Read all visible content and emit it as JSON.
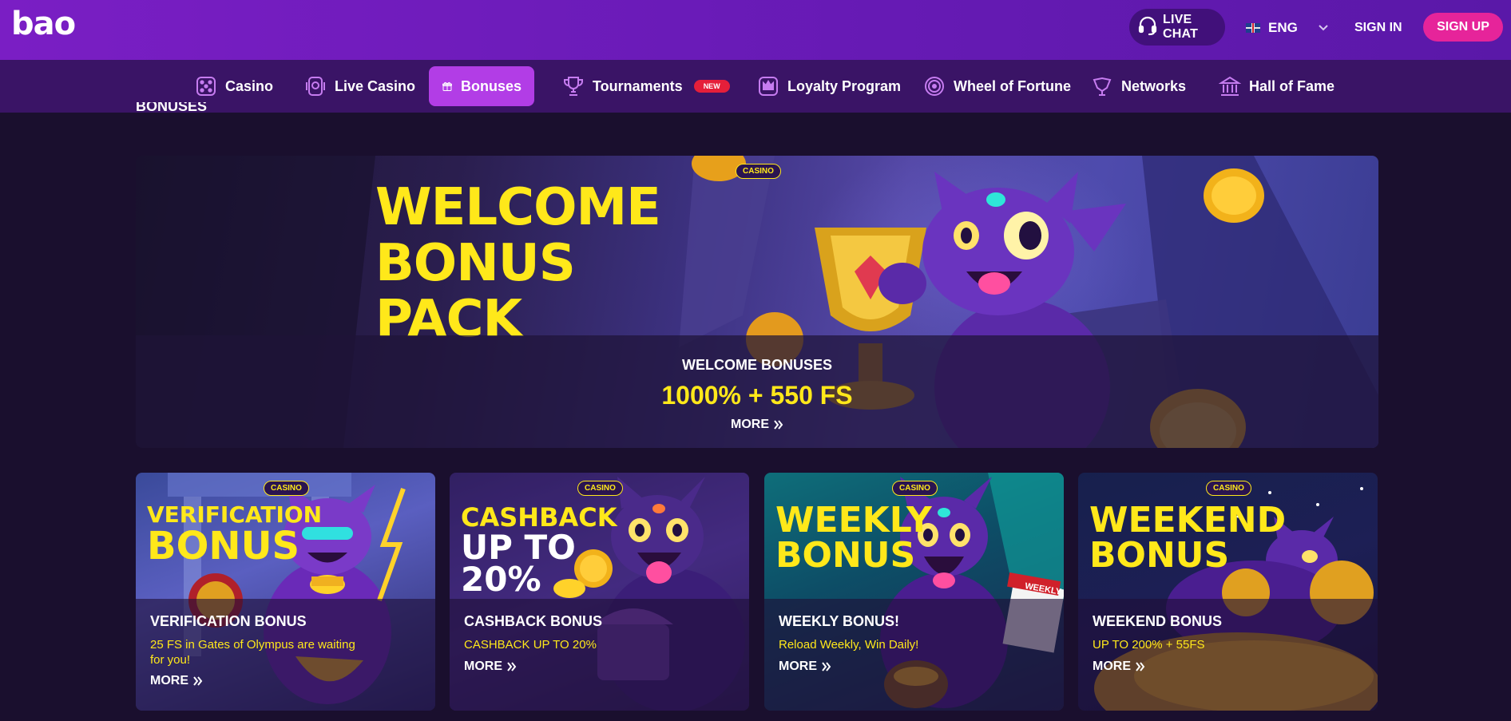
{
  "header": {
    "logo": "bao",
    "live_chat": "LIVE CHAT",
    "language": "ENG",
    "sign_in": "SIGN IN",
    "sign_up": "SIGN UP"
  },
  "nav": {
    "items": [
      {
        "label": "Casino",
        "icon": "dice-icon"
      },
      {
        "label": "Live Casino",
        "icon": "live-casino-icon"
      },
      {
        "label": "Bonuses",
        "icon": "gift-icon",
        "active": true
      },
      {
        "label": "Tournaments",
        "icon": "trophy-icon",
        "badge": "NEW"
      },
      {
        "label": "Loyalty Program",
        "icon": "crown-icon"
      },
      {
        "label": "Wheel of Fortune",
        "icon": "wheel-icon"
      },
      {
        "label": "Networks",
        "icon": "networks-icon"
      },
      {
        "label": "Hall of Fame",
        "icon": "hall-of-fame-icon"
      }
    ]
  },
  "page": {
    "title": "BONUSES"
  },
  "hero": {
    "badge": "CASINO",
    "headline": [
      "WELCOME",
      "BONUS",
      "PACK"
    ],
    "subtitle": "WELCOME BONUSES",
    "amount": "1000% + 550 FS",
    "more": "MORE"
  },
  "cards": [
    {
      "badge": "CASINO",
      "art_lines": [
        "VERIFICATION",
        "BONUS"
      ],
      "title": "VERIFICATION BONUS",
      "desc": "25 FS in Gates of Olympus are waiting for you!",
      "more": "MORE"
    },
    {
      "badge": "CASINO",
      "art_lines": [
        "CASHBACK",
        "UP TO",
        "20%"
      ],
      "title": "CASHBACK BONUS",
      "desc": "CASHBACK UP TO 20%",
      "more": "MORE"
    },
    {
      "badge": "CASINO",
      "art_lines": [
        "WEEKLY",
        "BONUS"
      ],
      "title": "WEEKLY BONUS!",
      "desc": "Reload Weekly, Win Daily!",
      "more": "MORE",
      "sign": "WEEKLY"
    },
    {
      "badge": "CASINO",
      "art_lines": [
        "WEEKEND",
        "BONUS"
      ],
      "title": "WEEKEND BONUS",
      "desc": "UP TO 200% + 55FS",
      "more": "MORE"
    }
  ],
  "colors": {
    "accent_yellow": "#ffe81a",
    "signup_pink": "#e6249a",
    "nav_active": "#b23de6",
    "header_purple": "#7a1ec4"
  }
}
